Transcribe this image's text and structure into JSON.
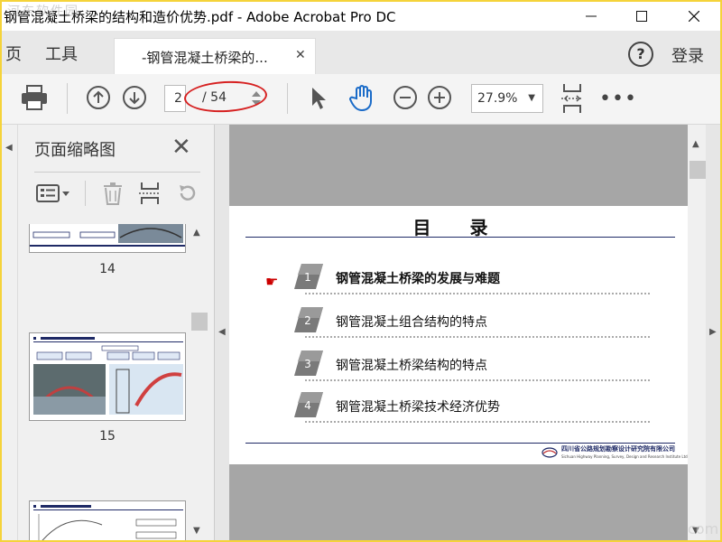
{
  "window": {
    "title": "钢管混凝土桥梁的结构和造价优势.pdf - Adobe Acrobat Pro DC",
    "watermark_top": "河东软件园",
    "watermark_bottom": "com"
  },
  "nav": {
    "home_label": "页",
    "tools_label": "工具",
    "doc_tab_label": "-钢管混凝土桥梁的...",
    "help_label": "?",
    "login_label": "登录"
  },
  "toolbar": {
    "current_page": "2",
    "total_pages": "/ 54",
    "zoom": "27.9%",
    "more_label": "•••"
  },
  "sidebar": {
    "title": "页面缩略图",
    "thumbnails": [
      {
        "page": "14"
      },
      {
        "page": "15"
      }
    ]
  },
  "document": {
    "heading": "目 录",
    "toc": [
      {
        "num": "1",
        "label": "钢管混凝土桥梁的发展与难题"
      },
      {
        "num": "2",
        "label": "钢管混凝土组合结构的特点"
      },
      {
        "num": "3",
        "label": "钢管混凝土桥梁结构的特点"
      },
      {
        "num": "4",
        "label": "钢管混凝土桥梁技术经济优势"
      }
    ],
    "pointer_glyph": "☛",
    "footer_org": "四川省公路规划勘察设计研究院有限公司",
    "footer_org_en": "Sichuan Highway Planning, Survey, Design and Research Institute Ltd."
  },
  "colors": {
    "accent_red": "#d62020",
    "navy": "#1f2a66",
    "frame_yellow": "#f5d33a"
  }
}
